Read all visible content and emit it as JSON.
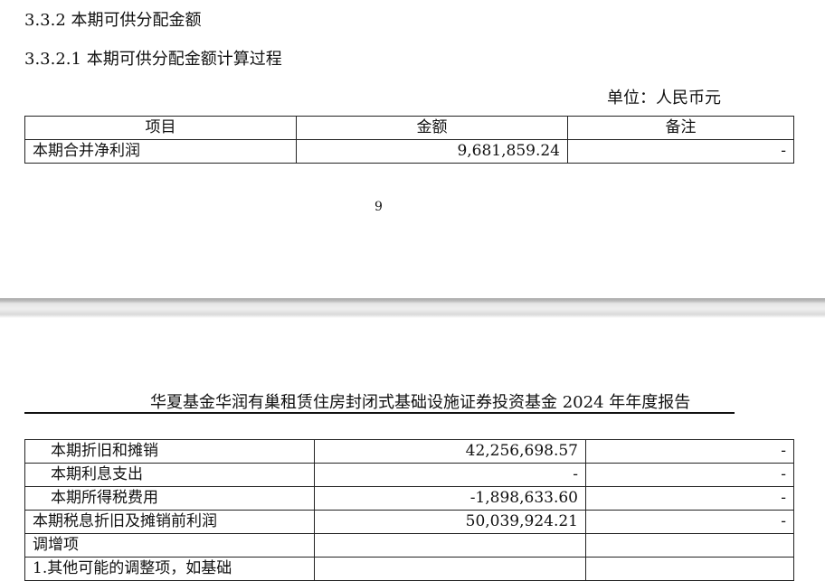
{
  "section": {
    "heading": "3.3.2 本期可供分配金额",
    "subheading": "3.3.2.1 本期可供分配金额计算过程",
    "unit": "单位：人民币元"
  },
  "table_top": {
    "headers": [
      "项目",
      "金额",
      "备注"
    ],
    "rows": [
      [
        "本期合并净利润",
        "9,681,859.24",
        "-"
      ]
    ]
  },
  "page_number": "9",
  "report_title": "华夏基金华润有巢租赁住房封闭式基础设施证券投资基金 2024 年年度报告",
  "table_bottom": {
    "rows": [
      [
        "本期折旧和摊销",
        "42,256,698.57",
        "-"
      ],
      [
        "本期利息支出",
        "-",
        "-"
      ],
      [
        "本期所得税费用",
        "-1,898,633.60",
        "-"
      ],
      [
        "本期税息折旧及摊销前利润",
        "50,039,924.21",
        "-"
      ],
      [
        "调增项",
        "",
        ""
      ],
      [
        "1.其他可能的调整项，如基础",
        "",
        ""
      ]
    ]
  }
}
